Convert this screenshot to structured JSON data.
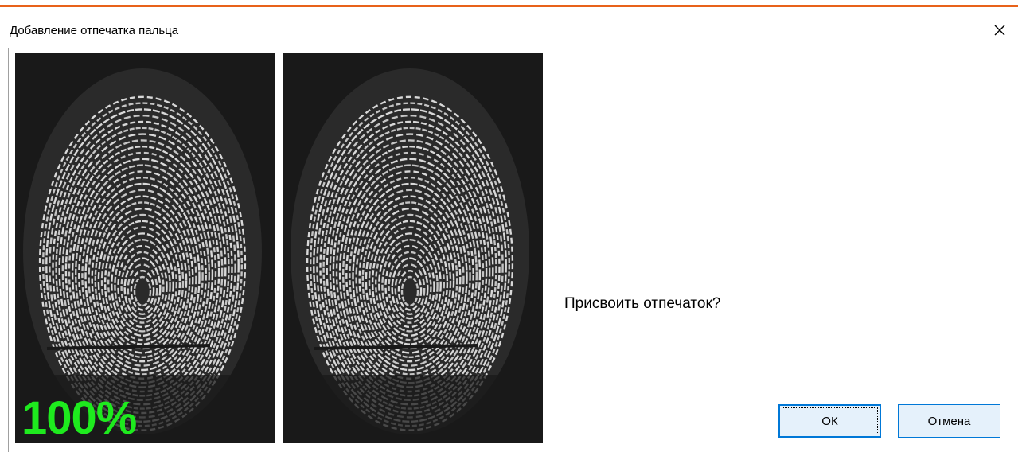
{
  "window": {
    "title": "Добавление отпечатка пальца",
    "accent_color": "#e8621a"
  },
  "scan": {
    "quality_label": "100%",
    "quality_color": "#1eea1e"
  },
  "dialog": {
    "prompt": "Присвоить отпечаток?",
    "ok_label": "ОК",
    "cancel_label": "Отмена"
  },
  "icons": {
    "close": "close-icon"
  }
}
